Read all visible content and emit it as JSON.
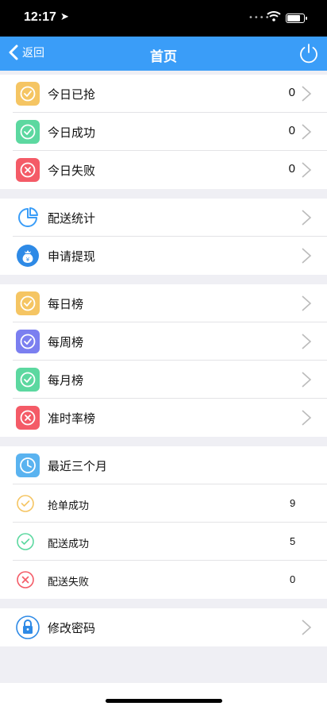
{
  "status_bar": {
    "time": "12:17"
  },
  "nav": {
    "back_label": "返回",
    "title": "首页"
  },
  "today": [
    {
      "label": "今日已抢",
      "value": "0",
      "icon": "check-circle-icon",
      "color": "#f5c563"
    },
    {
      "label": "今日成功",
      "value": "0",
      "icon": "check-circle-icon",
      "color": "#5cd8a0"
    },
    {
      "label": "今日失败",
      "value": "0",
      "icon": "x-circle-icon",
      "color": "#f45b67"
    }
  ],
  "delivery": [
    {
      "label": "配送统计",
      "icon": "pie-chart-icon",
      "color": "#3a9df8"
    },
    {
      "label": "申请提现",
      "icon": "money-bag-icon",
      "color": "#2e8ae6"
    }
  ],
  "rankings": [
    {
      "label": "每日榜",
      "icon": "check-circle-icon",
      "color": "#f5c563"
    },
    {
      "label": "每周榜",
      "icon": "check-circle-icon",
      "color": "#7b7ff0"
    },
    {
      "label": "每月榜",
      "icon": "check-circle-icon",
      "color": "#5cd8a0"
    },
    {
      "label": "准时率榜",
      "icon": "x-circle-icon",
      "color": "#f45b67"
    }
  ],
  "recent": {
    "header": "最近三个月",
    "header_icon": "clock-icon",
    "header_color": "#5ab3f0",
    "items": [
      {
        "label": "抢单成功",
        "value": "9",
        "icon": "check-outline-icon",
        "color": "#f5c563"
      },
      {
        "label": "配送成功",
        "value": "5",
        "icon": "check-outline-icon",
        "color": "#5cd8a0"
      },
      {
        "label": "配送失败",
        "value": "0",
        "icon": "x-outline-icon",
        "color": "#f45b67"
      }
    ]
  },
  "password": {
    "label": "修改密码",
    "icon": "lock-icon",
    "color": "#2e8ae6"
  }
}
